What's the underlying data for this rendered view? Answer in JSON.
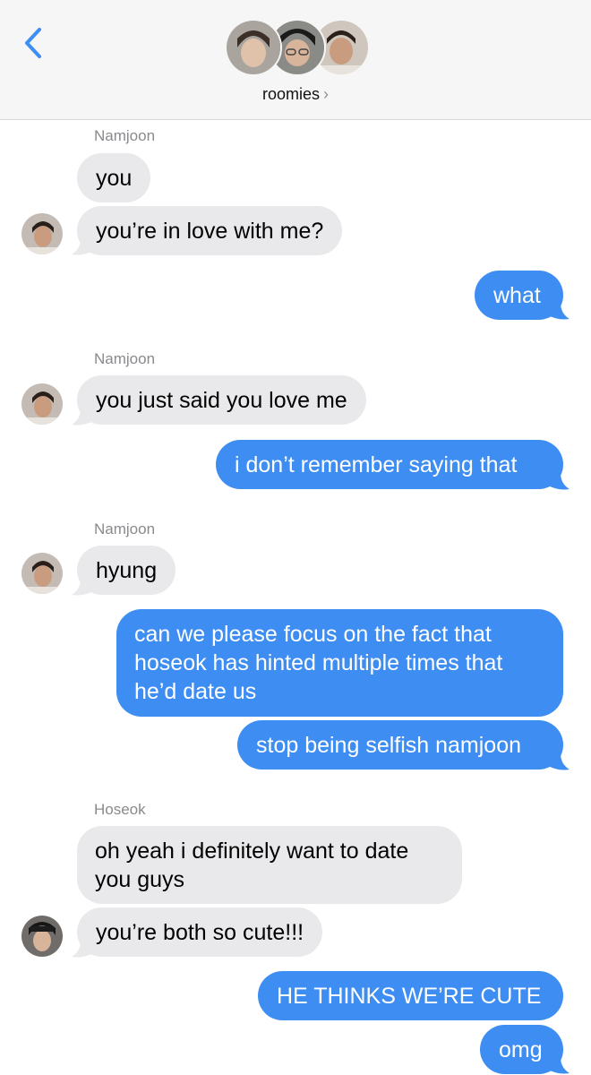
{
  "header": {
    "group_name": "roomies",
    "chevron": "›",
    "back_icon": "chevron-left-icon",
    "accent": "#3d8df2"
  },
  "messages": [
    {
      "sender": "Namjoon"
    },
    {
      "text": "you"
    },
    {
      "text": "you’re in love with me?"
    },
    {
      "text": "what"
    },
    {
      "sender": "Namjoon"
    },
    {
      "text": "you just said you love me"
    },
    {
      "text": "i don’t remember saying that"
    },
    {
      "sender": "Namjoon"
    },
    {
      "text": "hyung"
    },
    {
      "text": "can we please focus on the fact that hoseok has hinted multiple times that he’d date us"
    },
    {
      "text": "stop being selfish namjoon"
    },
    {
      "sender": "Hoseok"
    },
    {
      "text": "oh yeah i definitely want to date you guys"
    },
    {
      "text": "you’re both so cute!!!"
    },
    {
      "text": "HE THINKS WE’RE CUTE"
    },
    {
      "text": "omg"
    }
  ],
  "colors": {
    "incoming_bubble": "#e9e9eb",
    "outgoing_bubble": "#3d8df2",
    "header_bg": "#f6f6f6"
  }
}
